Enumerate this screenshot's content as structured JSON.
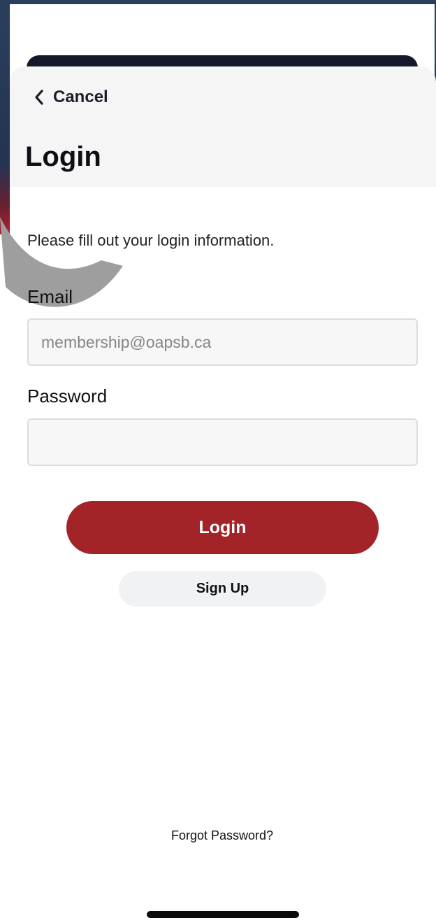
{
  "header": {
    "cancel_label": "Cancel",
    "title": "Login"
  },
  "form": {
    "instructions": "Please fill out your login information.",
    "email_label": "Email",
    "email_placeholder": "membership@oapsb.ca",
    "email_value": "",
    "password_label": "Password",
    "password_value": ""
  },
  "actions": {
    "login_label": "Login",
    "signup_label": "Sign Up",
    "forgot_label": "Forgot Password?"
  },
  "colors": {
    "primary": "#a22328",
    "secondary_bg": "#f1f2f4",
    "header_bg": "#f5f5f6"
  },
  "icons": {
    "back": "chevron-left-icon"
  }
}
